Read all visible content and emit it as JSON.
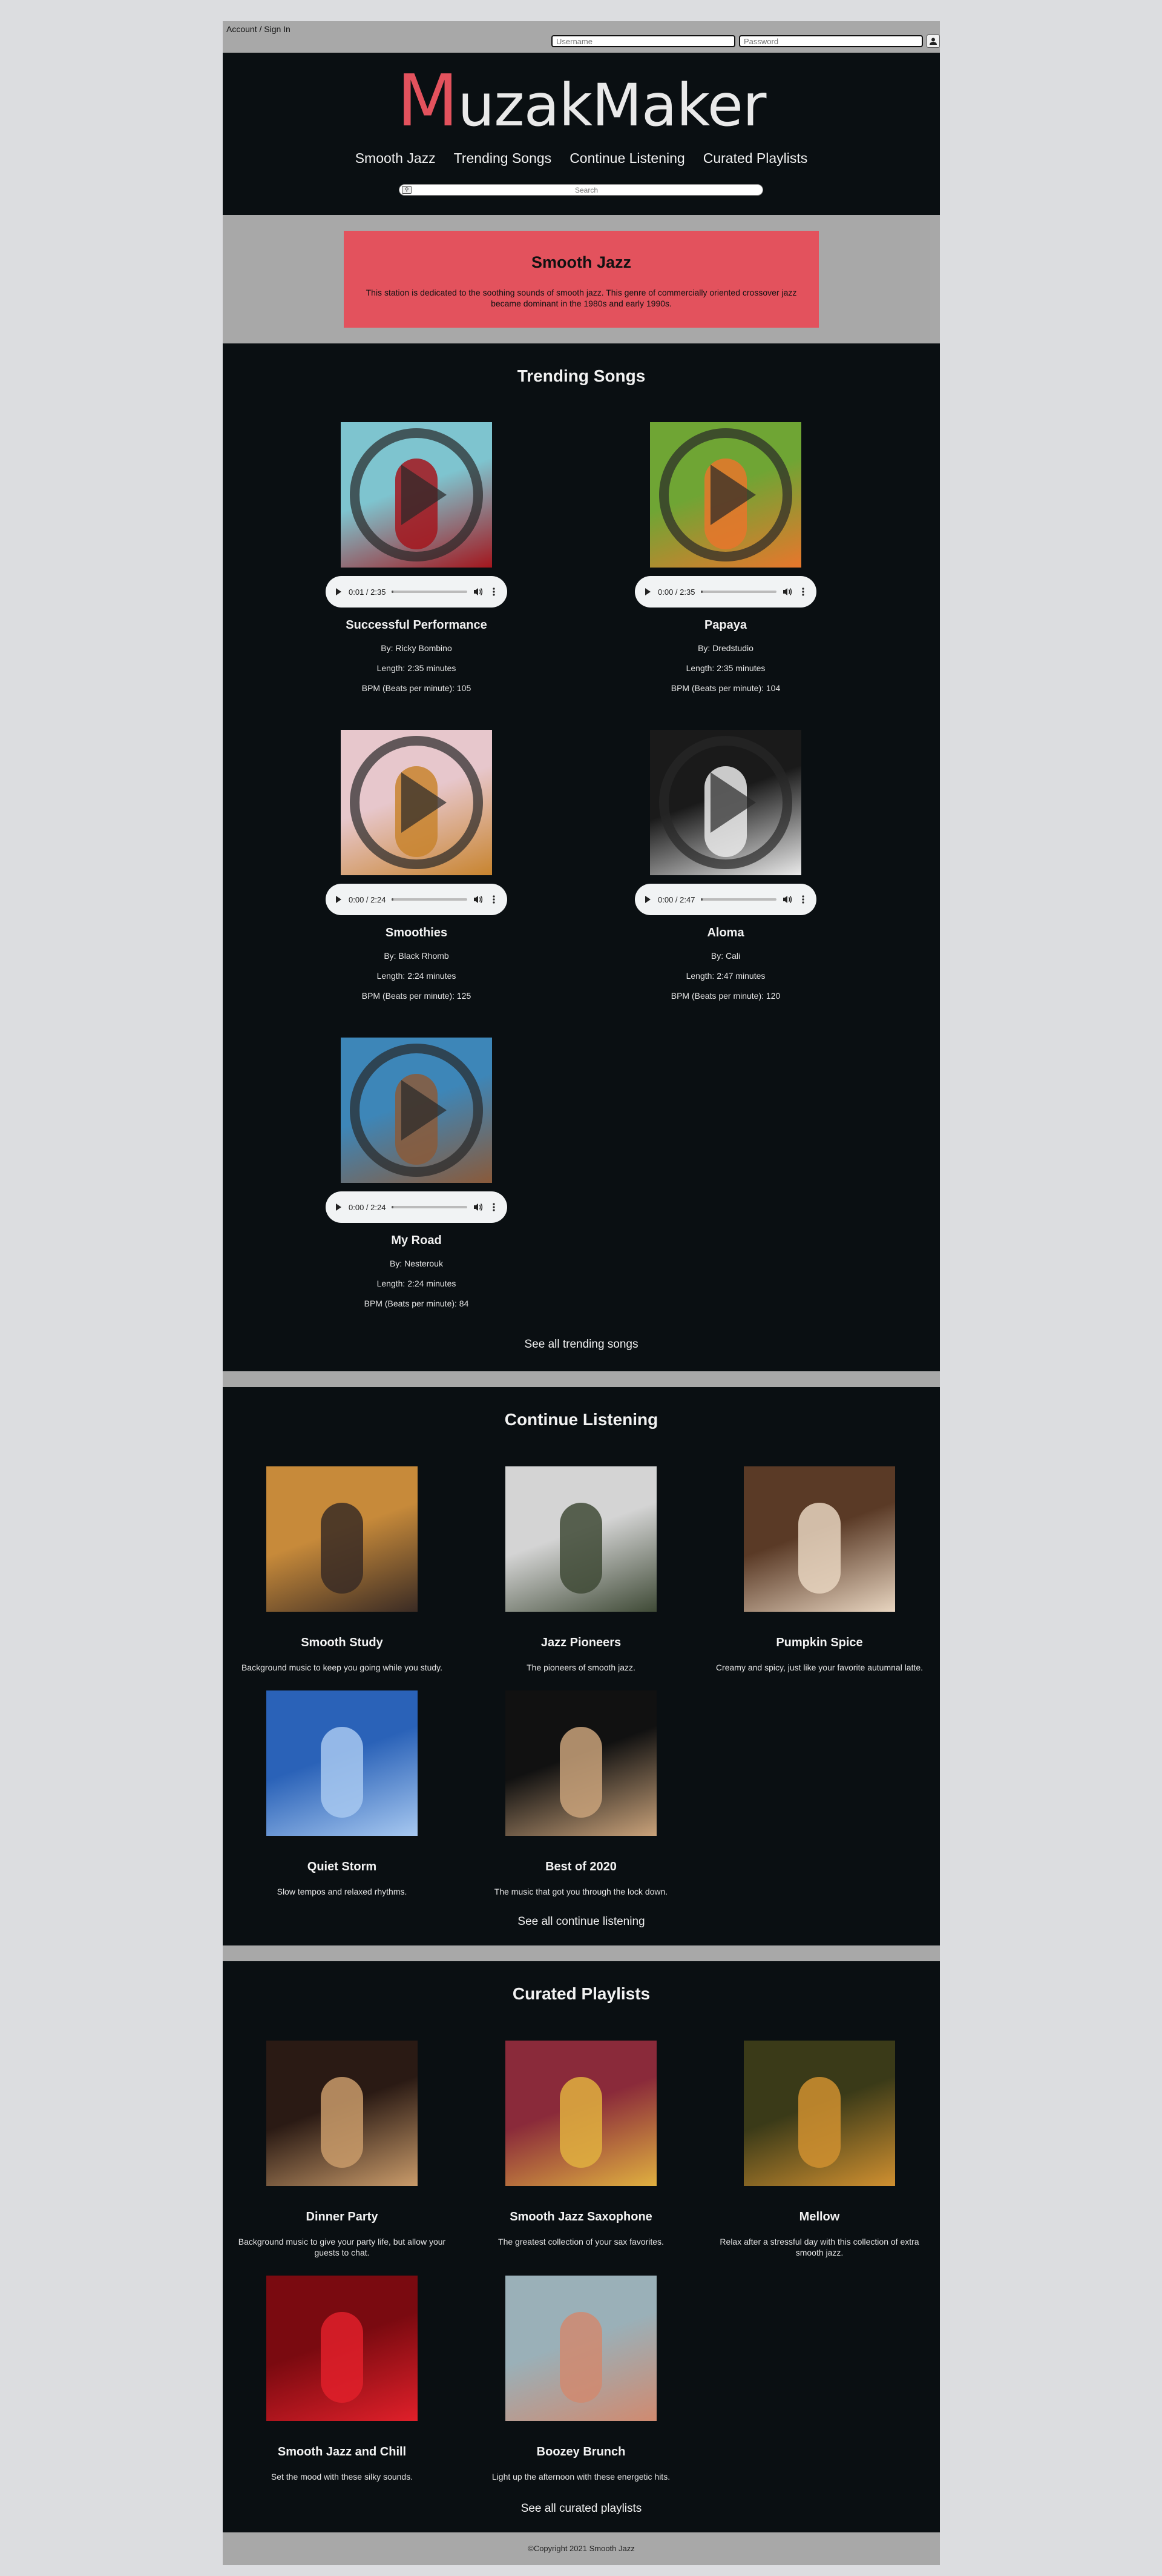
{
  "account": {
    "link": "Account / Sign In",
    "username_placeholder": "Username",
    "password_placeholder": "Password"
  },
  "header": {
    "logo_initial": "M",
    "logo_rest": "uzakMaker",
    "nav": [
      "Smooth Jazz",
      "Trending Songs",
      "Continue Listening",
      "Curated Playlists"
    ],
    "search_placeholder": "Search"
  },
  "station": {
    "title": "Smooth Jazz",
    "description": "This station is dedicated to the soothing sounds of smooth jazz. This genre of commercially oriented crossover jazz became dominant in the 1980s and early 1990s."
  },
  "trending": {
    "heading": "Trending Songs",
    "see_all": "See all trending songs",
    "songs": [
      {
        "title": "Successful Performance",
        "by": "By: Ricky Bombino",
        "length": "Length: 2:35 minutes",
        "bpm": "BPM (Beats per minute): 105",
        "time": "0:01 / 2:35",
        "progress": 0.007,
        "colors": [
          "#7ec4cf",
          "#a3161d"
        ]
      },
      {
        "title": "Papaya",
        "by": "By: Dredstudio",
        "length": "Length: 2:35 minutes",
        "bpm": "BPM (Beats per minute): 104",
        "time": "0:00 / 2:35",
        "progress": 0.0,
        "colors": [
          "#6fa534",
          "#e8762c"
        ]
      },
      {
        "title": "Smoothies",
        "by": "By: Black Rhomb",
        "length": "Length: 2:24 minutes",
        "bpm": "BPM (Beats per minute): 125",
        "time": "0:00 / 2:24",
        "progress": 0.0,
        "colors": [
          "#e7c7cc",
          "#c8842e"
        ]
      },
      {
        "title": "Aloma",
        "by": "By: Cali",
        "length": "Length: 2:47 minutes",
        "bpm": "BPM (Beats per minute): 120",
        "time": "0:00 / 2:47",
        "progress": 0.0,
        "colors": [
          "#1a1a1a",
          "#eaeaea"
        ]
      },
      {
        "title": "My Road",
        "by": "By: Nesterouk",
        "length": "Length: 2:24 minutes",
        "bpm": "BPM (Beats per minute): 84",
        "time": "0:00 / 2:24",
        "progress": 0.0,
        "colors": [
          "#3d86b8",
          "#8a5a3a"
        ]
      }
    ]
  },
  "continue": {
    "heading": "Continue Listening",
    "see_all": "See all continue listening",
    "items": [
      {
        "title": "Smooth Study",
        "desc": "Background music to keep you going while you study.",
        "colors": [
          "#c78a3a",
          "#3a2b24"
        ]
      },
      {
        "title": "Jazz Pioneers",
        "desc": "The pioneers of smooth jazz.",
        "colors": [
          "#d4d4d4",
          "#3f4a36"
        ]
      },
      {
        "title": "Pumpkin Spice",
        "desc": "Creamy and spicy, just like your favorite autumnal latte.",
        "colors": [
          "#5a3a26",
          "#e8d5c0"
        ]
      },
      {
        "title": "Quiet Storm",
        "desc": "Slow tempos and relaxed rhythms.",
        "colors": [
          "#2a62b8",
          "#a7c8f0"
        ]
      },
      {
        "title": "Best of 2020",
        "desc": "The music that got you through the lock down.",
        "colors": [
          "#111111",
          "#c9a27a"
        ]
      }
    ]
  },
  "curated": {
    "heading": "Curated Playlists",
    "see_all": "See all curated playlists",
    "items": [
      {
        "title": "Dinner Party",
        "desc": "Background music to give your party life, but allow your guests to chat.",
        "colors": [
          "#2a1a14",
          "#c99b6a"
        ]
      },
      {
        "title": "Smooth Jazz Saxophone",
        "desc": "The greatest collection of your sax favorites.",
        "colors": [
          "#8a2a3a",
          "#e0b040"
        ]
      },
      {
        "title": "Mellow",
        "desc": "Relax after a stressful day with this collection of extra smooth jazz.",
        "colors": [
          "#3a3a18",
          "#d09030"
        ]
      },
      {
        "title": "Smooth Jazz and Chill",
        "desc": "Set the mood with these silky sounds.",
        "colors": [
          "#7a0a10",
          "#e0202a"
        ]
      },
      {
        "title": "Boozey Brunch",
        "desc": "Light up the afternoon with these energetic hits.",
        "colors": [
          "#9ab0b8",
          "#d08a70"
        ]
      }
    ]
  },
  "footer": {
    "text": "©Copyright 2021 Smooth Jazz"
  }
}
